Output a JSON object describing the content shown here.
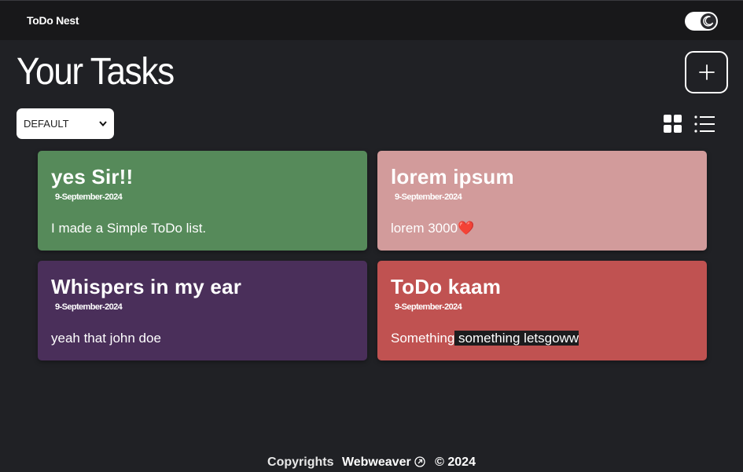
{
  "navbar": {
    "brand": "ToDo Nest",
    "theme_toggle_icon": "moon-icon"
  },
  "header": {
    "title": "Your Tasks",
    "add_button_icon": "plus-icon"
  },
  "toolbar": {
    "sort_selected": "DEFAULT",
    "grid_icon": "grid-view-icon",
    "list_icon": "list-view-icon"
  },
  "cards": [
    {
      "title": "yes Sir!!",
      "date": "9-September-2024",
      "body": "I made a Simple ToDo list.",
      "color": "#568a5a"
    },
    {
      "title": "lorem ipsum",
      "date": "9-September-2024",
      "body": "lorem 3000",
      "body_emoji": "❤️",
      "color": "#d29b9b"
    },
    {
      "title": "Whispers in my ear",
      "date": "9-September-2024",
      "body": "yeah that john doe",
      "color": "#4a2f5a"
    },
    {
      "title": "ToDo kaam",
      "date": "9-September-2024",
      "body_prefix": "Something",
      "body_selected": " something letsgoww ",
      "color": "#c05251"
    }
  ],
  "footer": {
    "copyright_label": "Copyrights",
    "author": "Webweaver",
    "author_icon": "external-link-icon",
    "year_text": "© 2024"
  }
}
